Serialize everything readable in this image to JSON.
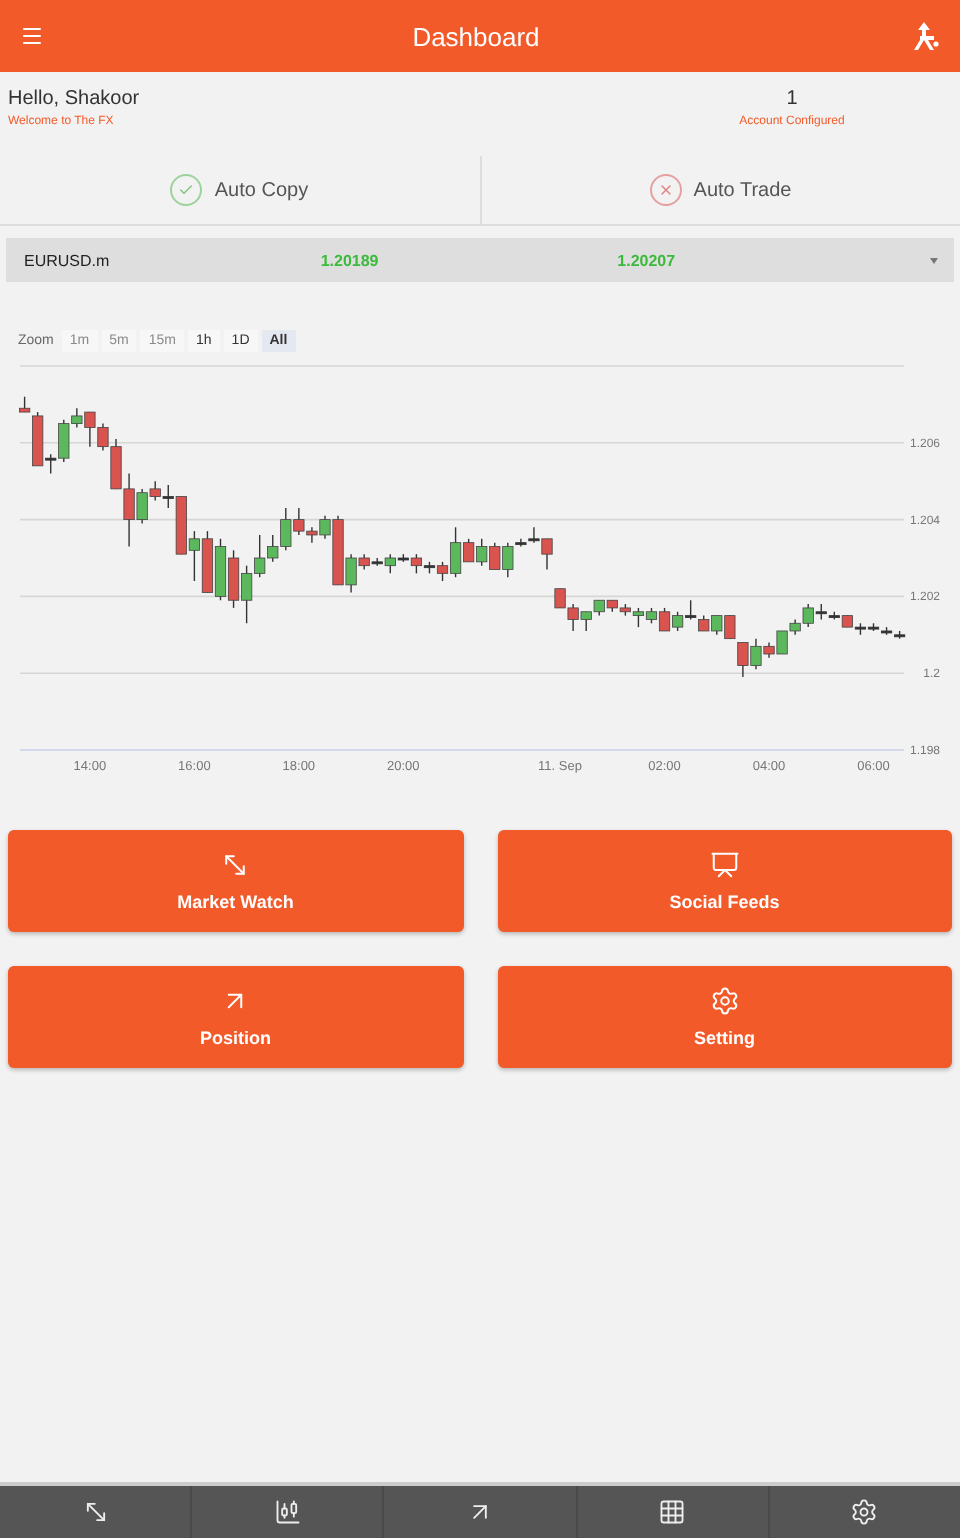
{
  "header": {
    "title": "Dashboard"
  },
  "greeting": {
    "title": "Hello, Shakoor",
    "subtitle": "Welcome to The FX",
    "count": "1",
    "count_label": "Account Configured"
  },
  "toggles": [
    {
      "label": "Auto Copy",
      "on": true
    },
    {
      "label": "Auto Trade",
      "on": false
    }
  ],
  "quote": {
    "symbol": "EURUSD.m",
    "bid": "1.20189",
    "ask": "1.20207"
  },
  "chart": {
    "zoom_label": "Zoom",
    "ranges": [
      {
        "label": "1m",
        "disabled": true,
        "selected": false
      },
      {
        "label": "5m",
        "disabled": true,
        "selected": false
      },
      {
        "label": "15m",
        "disabled": true,
        "selected": false
      },
      {
        "label": "1h",
        "disabled": false,
        "selected": false
      },
      {
        "label": "1D",
        "disabled": false,
        "selected": false
      },
      {
        "label": "All",
        "disabled": false,
        "selected": true
      }
    ],
    "chart_data": {
      "type": "candlestick",
      "grid": true,
      "ylim": [
        1.198,
        1.208
      ],
      "categories": [
        null,
        null,
        null,
        null,
        null,
        "14:00",
        null,
        null,
        null,
        null,
        null,
        null,
        null,
        "16:00",
        null,
        null,
        null,
        null,
        null,
        null,
        null,
        "18:00",
        null,
        null,
        null,
        null,
        null,
        null,
        null,
        "20:00",
        null,
        null,
        null,
        null,
        null,
        null,
        null,
        null,
        null,
        null,
        null,
        "11. Sep",
        null,
        null,
        null,
        null,
        null,
        null,
        null,
        "02:00",
        null,
        null,
        null,
        null,
        null,
        null,
        null,
        "04:00",
        null,
        null,
        null,
        null,
        null,
        null,
        null,
        "06:00",
        null,
        null
      ],
      "yticks": [
        {
          "value": 1.198,
          "label": "1.198"
        },
        {
          "value": 1.2,
          "label": "1.2"
        },
        {
          "value": 1.202,
          "label": "1.202"
        },
        {
          "value": 1.204,
          "label": "1.204"
        },
        {
          "value": 1.206,
          "label": "1.206"
        }
      ],
      "ohlc": [
        [
          1.2069,
          1.2072,
          1.2068,
          1.2068
        ],
        [
          1.2067,
          1.2068,
          1.2054,
          1.2054
        ],
        [
          1.2056,
          1.2057,
          1.2052,
          1.2056
        ],
        [
          1.2056,
          1.2066,
          1.2055,
          1.2065
        ],
        [
          1.2065,
          1.2069,
          1.2064,
          1.2067
        ],
        [
          1.2068,
          1.2068,
          1.2059,
          1.2064
        ],
        [
          1.2064,
          1.2065,
          1.2058,
          1.2059
        ],
        [
          1.2059,
          1.2061,
          1.2048,
          1.2048
        ],
        [
          1.2048,
          1.2052,
          1.2033,
          1.204
        ],
        [
          1.204,
          1.2048,
          1.2039,
          1.2047
        ],
        [
          1.2048,
          1.205,
          1.2045,
          1.2046
        ],
        [
          1.2046,
          1.2049,
          1.2043,
          1.2046
        ],
        [
          1.2046,
          1.2046,
          1.2031,
          1.2031
        ],
        [
          1.2032,
          1.2037,
          1.2024,
          1.2035
        ],
        [
          1.2035,
          1.2037,
          1.2021,
          1.2021
        ],
        [
          1.202,
          1.2035,
          1.2019,
          1.2033
        ],
        [
          1.203,
          1.2032,
          1.2017,
          1.2019
        ],
        [
          1.2019,
          1.2028,
          1.2013,
          1.2026
        ],
        [
          1.2026,
          1.2036,
          1.2025,
          1.203
        ],
        [
          1.203,
          1.2036,
          1.2029,
          1.2033
        ],
        [
          1.2033,
          1.2043,
          1.2032,
          1.204
        ],
        [
          1.204,
          1.2043,
          1.2036,
          1.2037
        ],
        [
          1.2037,
          1.2038,
          1.2034,
          1.2036
        ],
        [
          1.2036,
          1.2041,
          1.2035,
          1.204
        ],
        [
          1.204,
          1.2041,
          1.2023,
          1.2023
        ],
        [
          1.2023,
          1.2031,
          1.2021,
          1.203
        ],
        [
          1.203,
          1.2031,
          1.2027,
          1.2028
        ],
        [
          1.2029,
          1.203,
          1.2028,
          1.2029
        ],
        [
          1.2028,
          1.2031,
          1.2026,
          1.203
        ],
        [
          1.203,
          1.2031,
          1.2029,
          1.203
        ],
        [
          1.203,
          1.2031,
          1.2026,
          1.2028
        ],
        [
          1.2028,
          1.2029,
          1.2026,
          1.2028
        ],
        [
          1.2028,
          1.2029,
          1.2024,
          1.2026
        ],
        [
          1.2026,
          1.2038,
          1.2025,
          1.2034
        ],
        [
          1.2034,
          1.2035,
          1.2029,
          1.2029
        ],
        [
          1.2029,
          1.2035,
          1.2028,
          1.2033
        ],
        [
          1.2033,
          1.2034,
          1.2027,
          1.2027
        ],
        [
          1.2027,
          1.2034,
          1.2025,
          1.2033
        ],
        [
          1.2034,
          1.2035,
          1.2033,
          1.2034
        ],
        [
          1.2035,
          1.2038,
          1.2034,
          1.2035
        ],
        [
          1.2035,
          1.2035,
          1.2027,
          1.2031
        ],
        [
          1.2022,
          1.2022,
          1.2017,
          1.2017
        ],
        [
          1.2017,
          1.2018,
          1.2011,
          1.2014
        ],
        [
          1.2014,
          1.2016,
          1.2011,
          1.2016
        ],
        [
          1.2016,
          1.2019,
          1.2015,
          1.2019
        ],
        [
          1.2019,
          1.2019,
          1.2016,
          1.2017
        ],
        [
          1.2017,
          1.2018,
          1.2015,
          1.2016
        ],
        [
          1.2015,
          1.2017,
          1.2012,
          1.2016
        ],
        [
          1.2014,
          1.2017,
          1.2013,
          1.2016
        ],
        [
          1.2016,
          1.2017,
          1.2011,
          1.2011
        ],
        [
          1.2012,
          1.2016,
          1.2011,
          1.2015
        ],
        [
          1.2015,
          1.2019,
          1.2014,
          1.2015
        ],
        [
          1.2014,
          1.2015,
          1.2011,
          1.2011
        ],
        [
          1.2011,
          1.2015,
          1.201,
          1.2015
        ],
        [
          1.2015,
          1.2015,
          1.2009,
          1.2009
        ],
        [
          1.2008,
          1.2008,
          1.1999,
          1.2002
        ],
        [
          1.2002,
          1.2009,
          1.2001,
          1.2007
        ],
        [
          1.2007,
          1.2008,
          1.2004,
          1.2005
        ],
        [
          1.2005,
          1.2011,
          1.2005,
          1.2011
        ],
        [
          1.2011,
          1.2014,
          1.201,
          1.2013
        ],
        [
          1.2013,
          1.2018,
          1.2012,
          1.2017
        ],
        [
          1.2016,
          1.2018,
          1.2014,
          1.2016
        ],
        [
          1.2015,
          1.2016,
          1.2014,
          1.2015
        ],
        [
          1.2015,
          1.2015,
          1.2012,
          1.2012
        ],
        [
          1.2012,
          1.2013,
          1.201,
          1.2012
        ],
        [
          1.2012,
          1.2013,
          1.2011,
          1.2012
        ],
        [
          1.2011,
          1.2012,
          1.201,
          1.2011
        ],
        [
          1.201,
          1.2011,
          1.2009,
          1.201
        ]
      ]
    }
  },
  "tiles": [
    {
      "kind": "watch",
      "label": "Market Watch"
    },
    {
      "kind": "feeds",
      "label": "Social Feeds"
    },
    {
      "kind": "position",
      "label": "Position"
    },
    {
      "kind": "setting",
      "label": "Setting"
    }
  ],
  "bottom_nav": [
    {
      "kind": "watch"
    },
    {
      "kind": "candles"
    },
    {
      "kind": "position"
    },
    {
      "kind": "grid"
    },
    {
      "kind": "setting"
    }
  ]
}
